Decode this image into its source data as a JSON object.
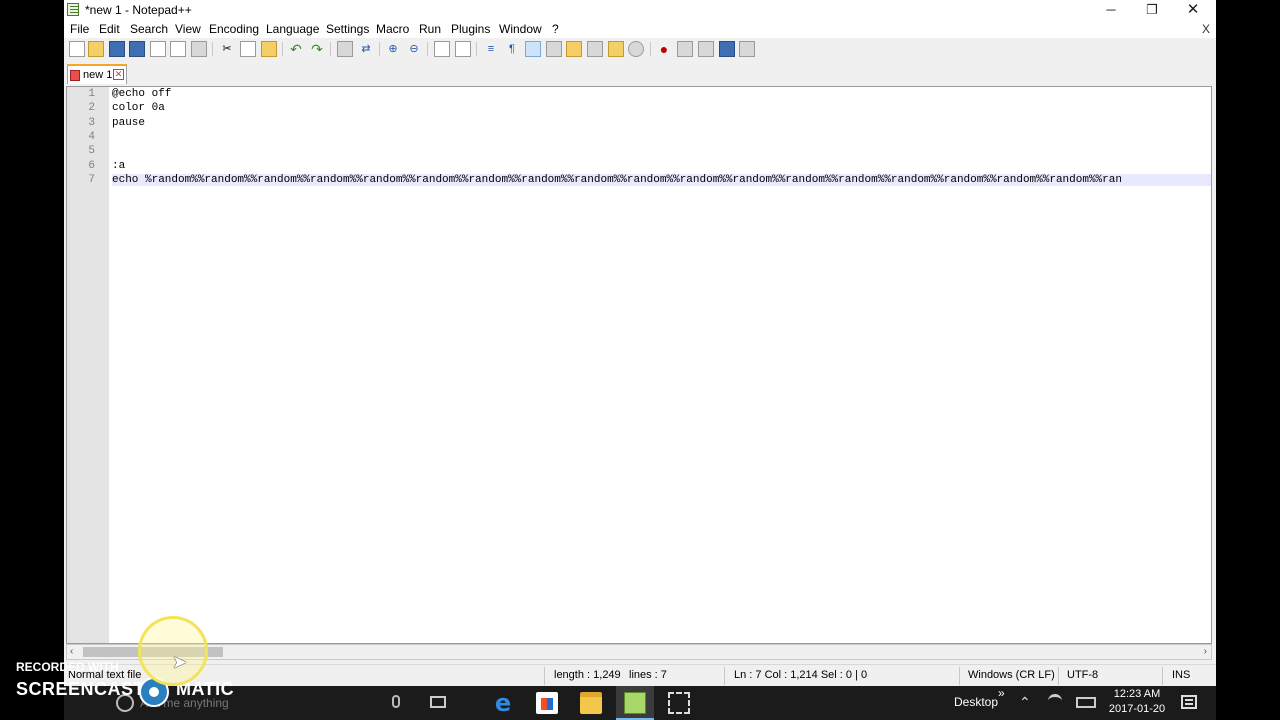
{
  "window": {
    "title": "*new 1 - Notepad++",
    "minimize_glyph": "─",
    "maximize_glyph": "❐",
    "close_glyph": "✕"
  },
  "menu": {
    "items": [
      "File",
      "Edit",
      "Search",
      "View",
      "Encoding",
      "Language",
      "Settings",
      "Macro",
      "Run",
      "Plugins",
      "Window",
      "?"
    ],
    "close_doc": "X"
  },
  "toolbar": {
    "icons": [
      "new-file-icon",
      "open-file-icon",
      "save-icon",
      "save-all-icon",
      "close-icon",
      "close-all-icon",
      "print-icon",
      "cut-icon",
      "copy-icon",
      "paste-icon",
      "undo-icon",
      "redo-icon",
      "find-icon",
      "replace-icon",
      "zoom-in-icon",
      "zoom-out-icon",
      "sync-vertical-icon",
      "sync-horizontal-icon",
      "word-wrap-icon",
      "show-all-chars-icon",
      "indent-guide-icon",
      "udl-icon",
      "doc-map-icon",
      "function-list-icon",
      "folder-as-workspace-icon",
      "monitoring-icon",
      "record-macro-icon",
      "stop-macro-icon",
      "play-macro-icon",
      "run-macro-multiple-icon",
      "save-macro-icon"
    ]
  },
  "tabs": [
    {
      "label": "new 1",
      "modified": true
    }
  ],
  "editor": {
    "lines": [
      {
        "num": "1",
        "text": "@echo off"
      },
      {
        "num": "2",
        "text": "color 0a"
      },
      {
        "num": "3",
        "text": "pause"
      },
      {
        "num": "4",
        "text": ""
      },
      {
        "num": "5",
        "text": ""
      },
      {
        "num": "6",
        "text": ":a"
      },
      {
        "num": "7",
        "text": "echo %random%%random%%random%%random%%random%%random%%random%%random%%random%%random%%random%%random%%random%%random%%random%%random%%random%%random%%ran"
      }
    ]
  },
  "scrollbar": {
    "left_arrow": "‹",
    "right_arrow": "›"
  },
  "status": {
    "file_type": "Normal text file",
    "length": "length : 1,249",
    "lines": "lines : 7",
    "position": "Ln : 7    Col : 1,214    Sel : 0 | 0",
    "eol": "Windows (CR LF)",
    "encoding": "UTF-8",
    "mode": "INS"
  },
  "taskbar": {
    "search_placeholder": "Ask me anything",
    "desktop_label": "Desktop",
    "desktop_chevron": "»",
    "time": "12:23 AM",
    "date": "2017-01-20",
    "edge_glyph": "e"
  },
  "watermark": {
    "recorded_with": "RECORDED WITH",
    "brand_left": "SCREENCAST",
    "brand_right": "MATIC"
  },
  "cursor": {
    "glyph": "➤"
  },
  "colors": {
    "tab_accent": "#f5a623",
    "selection_line": "#e8e8ff",
    "gutter": "#e4e4e4",
    "taskbar": "#1b1b1b",
    "taskbar_accent": "#76b9ed"
  }
}
